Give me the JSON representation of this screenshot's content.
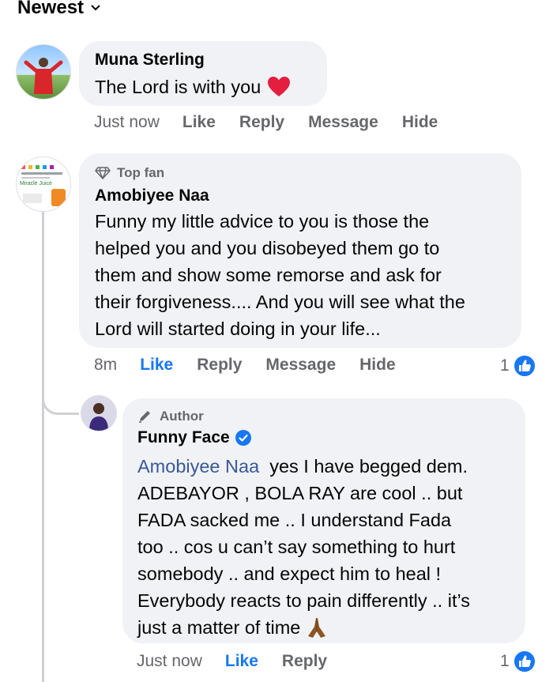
{
  "sort": {
    "label": "Newest"
  },
  "comments": [
    {
      "author": "Muna Sterling",
      "text": "The Lord is with you",
      "actions": {
        "time": "Just now",
        "like": "Like",
        "reply": "Reply",
        "message": "Message",
        "hide": "Hide"
      }
    },
    {
      "badge": "Top fan",
      "author": "Amobiyee Naa",
      "text_lines": [
        "Funny my little advice to you is those the",
        "helped you and you disobeyed them go to",
        "them and show some remorse and ask for",
        "their forgiveness.... And you will see what the",
        "Lord will started doing in your life..."
      ],
      "actions": {
        "time": "8m",
        "like": "Like",
        "reply": "Reply",
        "message": "Message",
        "hide": "Hide"
      },
      "reaction_count": "1",
      "avatar_text": "Miracle Juice"
    },
    {
      "badge": "Author",
      "author": "Funny Face",
      "mention": "Amobiyee Naa",
      "first_line_rest": "yes I have begged dem.",
      "text_lines": [
        "ADEBAYOR  , BOLA RAY are cool .. but",
        "FADA sacked me .. I understand Fada",
        "too .. cos u can’t say something to hurt",
        "somebody .. and expect him to heal !",
        "Everybody reacts to pain differently .. it’s",
        "just a matter of time"
      ],
      "actions": {
        "time": "Just now",
        "like": "Like",
        "reply": "Reply"
      },
      "reaction_count": "1"
    }
  ],
  "colors": {
    "bubble": "#f0f2f5",
    "accent": "#1877f2",
    "muted": "#65676b",
    "heart": "#e41e3f"
  }
}
